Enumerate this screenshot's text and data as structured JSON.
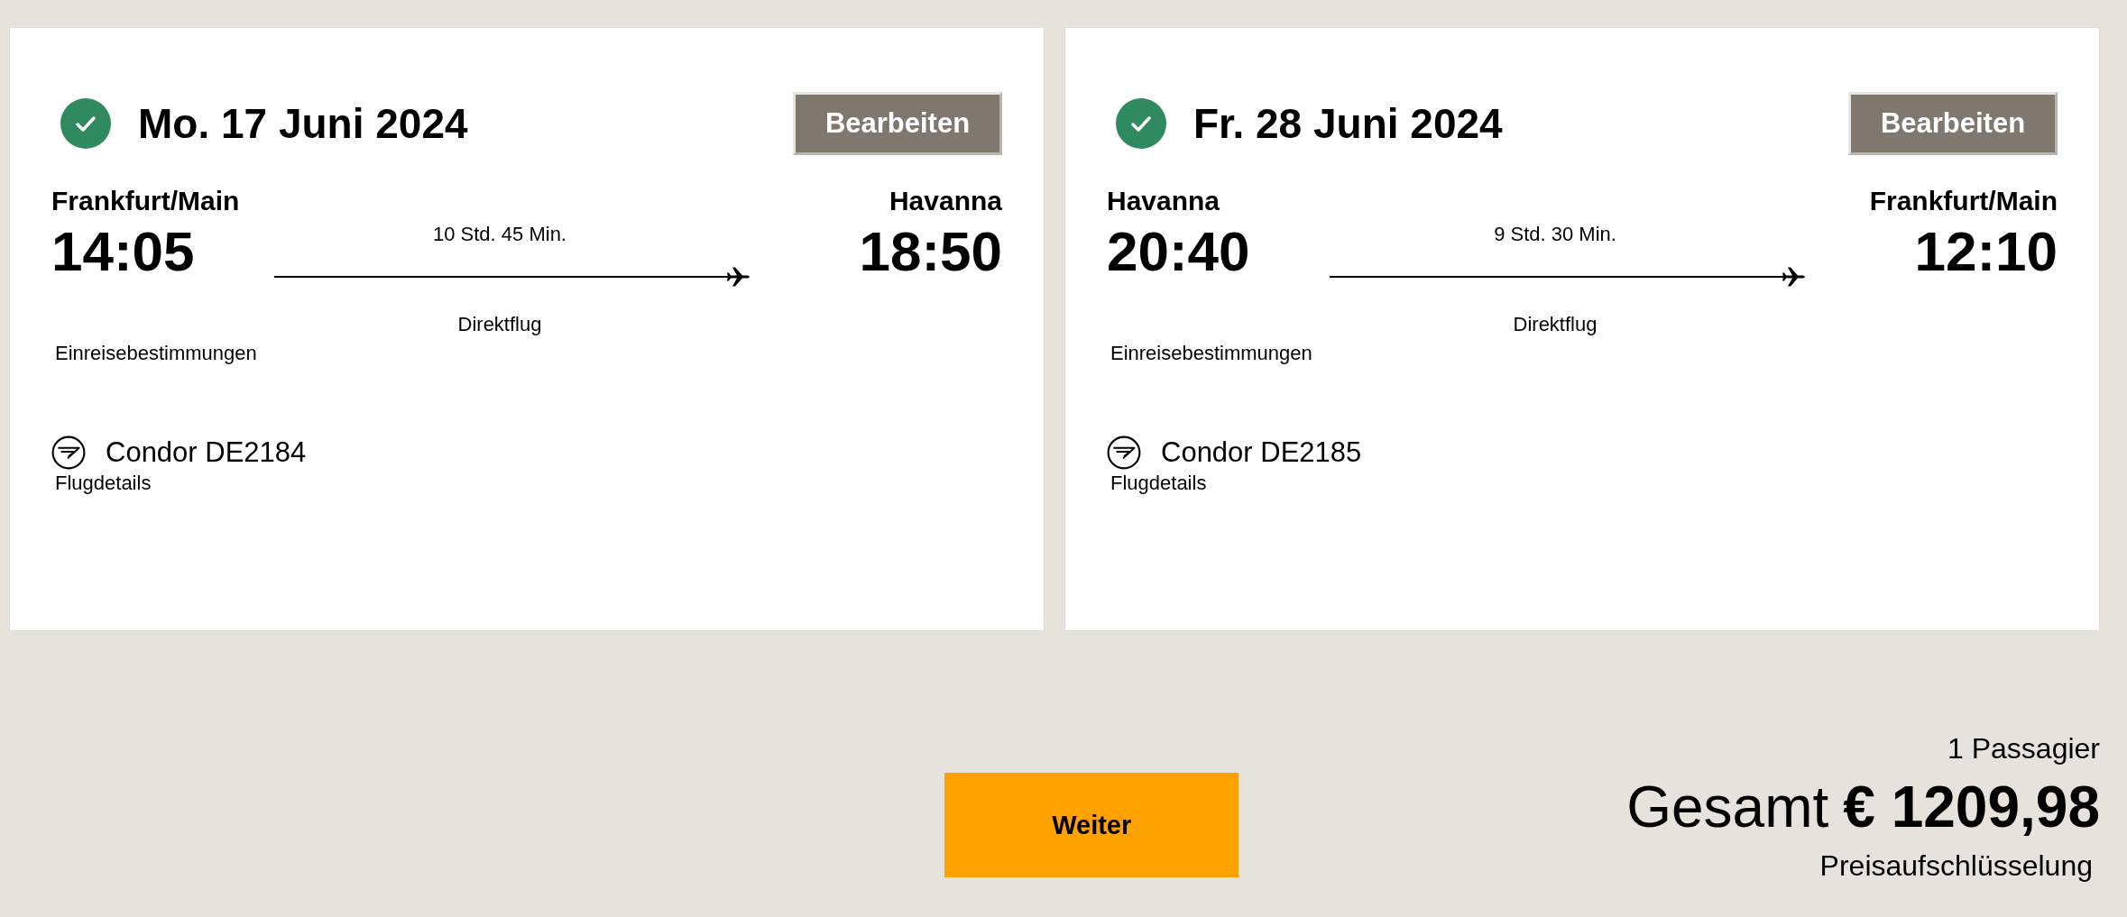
{
  "flights": [
    {
      "confirmed": true,
      "date": "Mo. 17 Juni 2024",
      "edit_button": "Bearbeiten",
      "origin": "Frankfurt/Main",
      "departure": "14:05",
      "duration": "10 Std. 45 Min.",
      "stops": "Direktflug",
      "destination": "Havanna",
      "arrival": "18:50",
      "entry_link": "Einreisebestimmungen",
      "airline": "Condor DE2184",
      "details_link": "Flugdetails"
    },
    {
      "confirmed": true,
      "date": "Fr. 28 Juni 2024",
      "edit_button": "Bearbeiten",
      "origin": "Havanna",
      "departure": "20:40",
      "duration": "9 Std. 30 Min.",
      "stops": "Direktflug",
      "destination": "Frankfurt/Main",
      "arrival": "12:10",
      "entry_link": "Einreisebestimmungen",
      "airline": "Condor DE2185",
      "details_link": "Flugdetails"
    }
  ],
  "continue_button": "Weiter",
  "summary": {
    "passengers": "1 Passagier",
    "total_label": "Gesamt",
    "total": "€ 1209,98",
    "breakdown_link": "Preisaufschlüsselung"
  }
}
